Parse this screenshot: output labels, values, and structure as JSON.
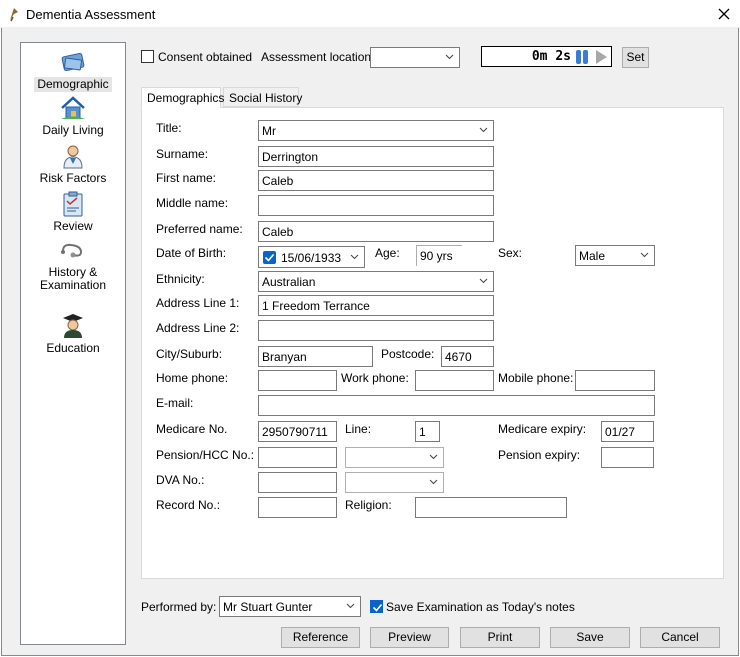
{
  "window": {
    "title": "Dementia Assessment"
  },
  "nav": {
    "items": [
      {
        "label": "Demographic"
      },
      {
        "label": "Daily Living"
      },
      {
        "label": "Risk Factors"
      },
      {
        "label": "Review"
      },
      {
        "label": "History &\nExamination"
      },
      {
        "label": "Education"
      }
    ]
  },
  "top": {
    "consent_label": "Consent obtained",
    "consent_checked": false,
    "location_label": "Assessment location:",
    "location_value": "",
    "timer_value": "0m  2s",
    "set_label": "Set"
  },
  "tabs": [
    "Demographics",
    "Social History"
  ],
  "form": {
    "title_label": "Title:",
    "title_value": "Mr",
    "surname_label": "Surname:",
    "surname_value": "Derrington",
    "firstname_label": "First name:",
    "firstname_value": "Caleb",
    "middlename_label": "Middle name:",
    "middlename_value": "",
    "preferred_label": "Preferred name:",
    "preferred_value": "Caleb",
    "dob_label": "Date of Birth:",
    "dob_value": "15/06/1933",
    "age_label": "Age:",
    "age_value": "90 yrs",
    "sex_label": "Sex:",
    "sex_value": "Male",
    "ethnicity_label": "Ethnicity:",
    "ethnicity_value": "Australian",
    "addr1_label": "Address Line 1:",
    "addr1_value": "1 Freedom Terrance",
    "addr2_label": "Address Line 2:",
    "addr2_value": "",
    "city_label": "City/Suburb:",
    "city_value": "Branyan",
    "postcode_label": "Postcode:",
    "postcode_value": "4670",
    "homephone_label": "Home phone:",
    "homephone_value": "",
    "workphone_label": "Work phone:",
    "workphone_value": "",
    "mobile_label": "Mobile phone:",
    "mobile_value": "",
    "email_label": "E-mail:",
    "email_value": "",
    "medicare_label": "Medicare No.",
    "medicare_value": "2950790711",
    "line_label": "Line:",
    "line_value": "1",
    "medicare_expiry_label": "Medicare expiry:",
    "medicare_expiry_value": "01/27",
    "pension_label": "Pension/HCC No.:",
    "pension_value": "",
    "pension_type_value": "",
    "pension_expiry_label": "Pension expiry:",
    "pension_expiry_value": "",
    "dva_label": "DVA No.:",
    "dva_value": "",
    "dva_type_value": "",
    "record_label": "Record No.:",
    "record_value": "",
    "religion_label": "Religion:",
    "religion_value": ""
  },
  "footer": {
    "performed_label": "Performed by:",
    "performed_value": "Mr Stuart Gunter",
    "save_notes_label": "Save Examination as Today's notes",
    "save_notes_checked": true,
    "buttons": {
      "reference": "Reference",
      "preview": "Preview",
      "print": "Print",
      "save": "Save",
      "cancel": "Cancel"
    }
  },
  "colors": {
    "accent": "#0a64c8",
    "window_bg": "#f0f0f0",
    "button_bg": "#e1e1e1",
    "timer_bar": "#3a7bd5"
  }
}
